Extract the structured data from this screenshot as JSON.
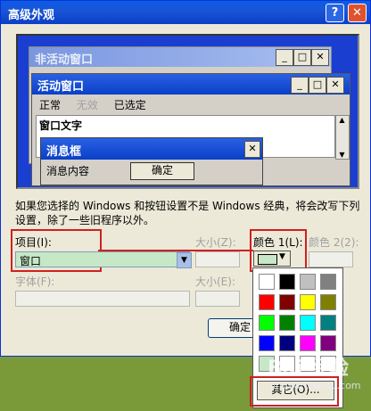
{
  "window": {
    "title": "高级外观",
    "help": "?",
    "close": "✕"
  },
  "preview": {
    "inactive_title": "非活动窗口",
    "active_title": "活动窗口",
    "menu": {
      "normal": "正常",
      "disabled": "无效",
      "selected": "已选定"
    },
    "window_text": "窗口文字",
    "msgbox_title": "消息框",
    "msgbox_text": "消息内容",
    "msgbox_ok": "确定",
    "btn_min": "_",
    "btn_max": "□",
    "btn_close": "✕",
    "scroll_up": "▲",
    "scroll_down": "▼"
  },
  "note": "如果您选择的 Windows 和按钮设置不是 Windows 经典，将会改写下列设置，除了一些旧程序以外。",
  "item": {
    "label": "项目(I):",
    "value": "窗口",
    "dropdown": "▼"
  },
  "size1": {
    "label": "大小(Z):"
  },
  "color1": {
    "label": "颜色 1(L):",
    "value": "#c6e8c6",
    "dropdown": "▼"
  },
  "color2": {
    "label": "颜色 2(2):"
  },
  "font": {
    "label": "字体(F):"
  },
  "size2": {
    "label": "大小(E):"
  },
  "palette": {
    "colors": [
      "#ffffff",
      "#000000",
      "#c0c0c0",
      "#808080",
      "#ff0000",
      "#800000",
      "#ffff00",
      "#808000",
      "#00ff00",
      "#008000",
      "#00ffff",
      "#008080",
      "#0000ff",
      "#000080",
      "#ff00ff",
      "#800080",
      "#c6e8c6",
      "#ffffff",
      "#ffffff",
      "#ffffff"
    ],
    "other_label": "其它(O)..."
  },
  "ok_label": "确定",
  "watermark": {
    "logo": "Bai 经验",
    "url": "jingyan.baidu.com"
  }
}
